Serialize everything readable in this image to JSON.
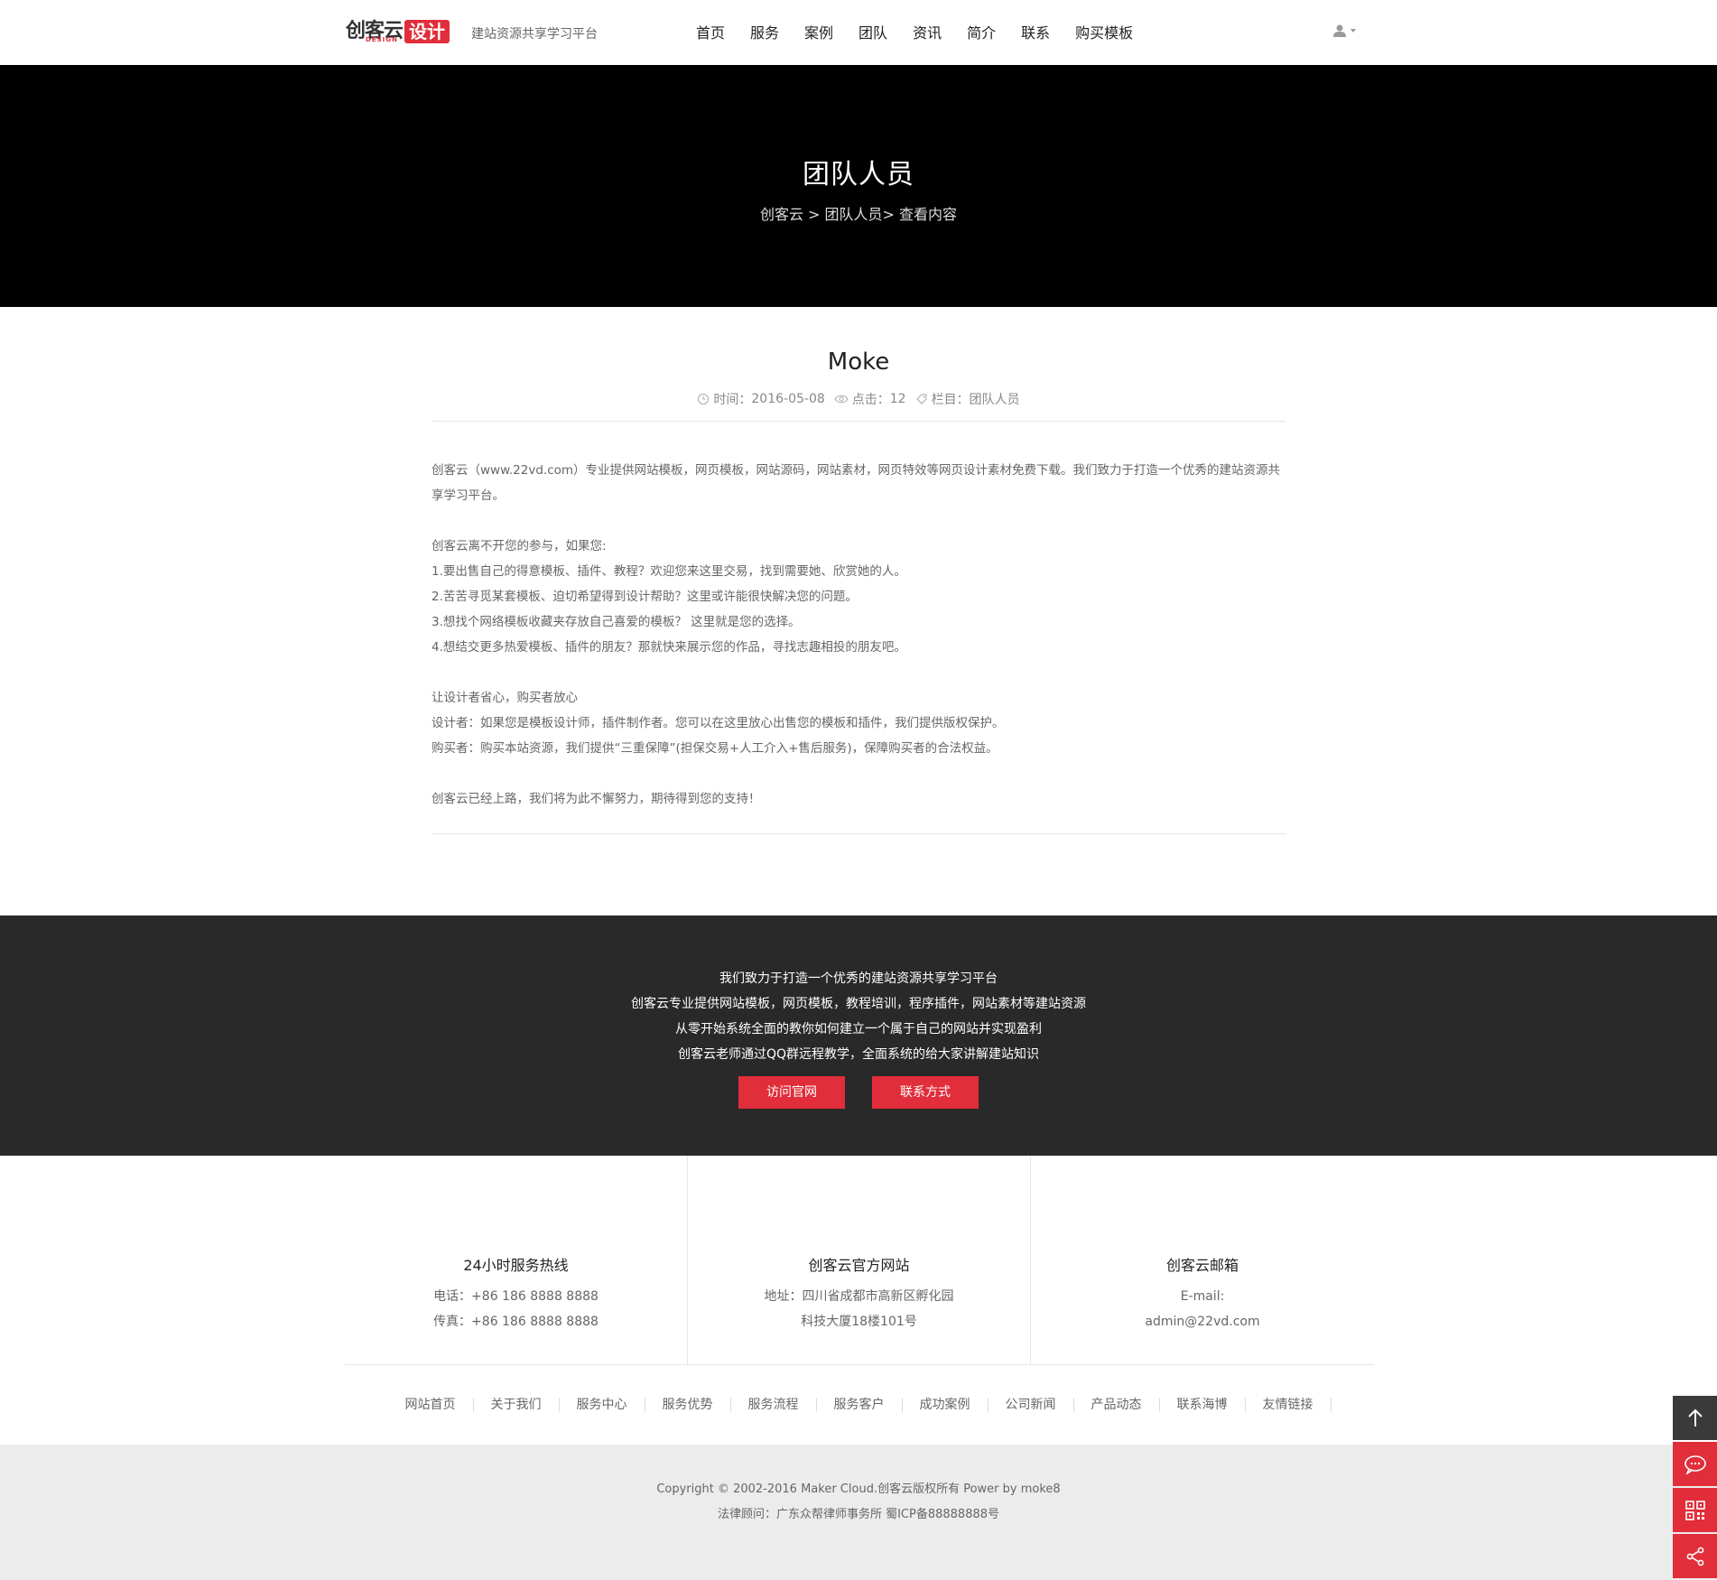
{
  "header": {
    "logo_cn": "创客云",
    "logo_en": "DESIGN",
    "logo_box": "设计",
    "slogan": "建站资源共享学习平台",
    "nav": [
      "首页",
      "服务",
      "案例",
      "团队",
      "资讯",
      "简介",
      "联系",
      "购买模板"
    ],
    "user_icon": "user-icon"
  },
  "banner": {
    "title": "团队人员",
    "breadcrumb": [
      "创客云",
      " > ",
      "团队人员",
      "> ",
      "查看内容"
    ]
  },
  "article": {
    "title": "Moke",
    "meta": {
      "time_label": "时间：",
      "time": "2016-05-08",
      "clicks_label": "点击：",
      "clicks": "12",
      "column_label": "栏目：",
      "column": "团队人员"
    },
    "paragraphs": [
      "创客云（www.22vd.com）专业提供网站模板，网页模板，网站源码，网站素材，网页特效等网页设计素材免费下载。我们致力于打造一个优秀的建站资源共享学习平台。",
      "",
      "创客云离不开您的参与，如果您:",
      "1.要出售自己的得意模板、插件、教程？欢迎您来这里交易，找到需要她、欣赏她的人。",
      "2.苦苦寻觅某套模板、迫切希望得到设计帮助？这里或许能很快解决您的问题。",
      "3.想找个网络模板收藏夹存放自己喜爱的模板？ 这里就是您的选择。",
      "4.想结交更多热爱模板、插件的朋友？那就快来展示您的作品，寻找志趣相投的朋友吧。",
      "",
      "让设计者省心，购买者放心",
      "设计者：如果您是模板设计师，插件制作者。您可以在这里放心出售您的模板和插件，我们提供版权保护。",
      "购买者：购买本站资源，我们提供“三重保障”(担保交易+人工介入+售后服务)，保障购买者的合法权益。",
      "",
      "创客云已经上路，我们将为此不懈努力，期待得到您的支持！"
    ]
  },
  "band": {
    "lines": [
      "我们致力于打造一个优秀的建站资源共享学习平台",
      "创客云专业提供网站模板，网页模板，教程培训，程序插件，网站素材等建站资源",
      "从零开始系统全面的教你如何建立一个属于自己的网站并实现盈利",
      "创客云老师通过QQ群远程教学，全面系统的给大家讲解建站知识"
    ],
    "btn_visit": "访问官网",
    "btn_contact": "联系方式"
  },
  "info": {
    "col1": {
      "title": "24小时服务热线",
      "line1": "电话：+86 186 8888 8888",
      "line2": "传真：+86 186 8888 8888"
    },
    "col2": {
      "title": "创客云官方网站",
      "line1": "地址：四川省成都市高新区孵化园",
      "line2": "科技大厦18楼101号"
    },
    "col3": {
      "title": "创客云邮箱",
      "line1": "E-mail:",
      "line2": "admin@22vd.com"
    }
  },
  "links": [
    "网站首页",
    "关于我们",
    "服务中心",
    "服务优势",
    "服务流程",
    "服务客户",
    "成功案例",
    "公司新闻",
    "产品动态",
    "联系海博",
    "友情链接"
  ],
  "copyright": {
    "line1": "Copyright © 2002-2016 Maker Cloud.创客云版权所有 Power by moke8",
    "line2": "法律顾问：广东众帮律师事务所 蜀ICP备88888888号"
  },
  "side": [
    "arrow-up-icon",
    "chat-icon",
    "qrcode-icon",
    "share-icon"
  ],
  "colors": {
    "accent": "#e12e3a",
    "band_bg": "#292929",
    "banner_bg": "#000000",
    "copy_bg": "#ececec"
  }
}
